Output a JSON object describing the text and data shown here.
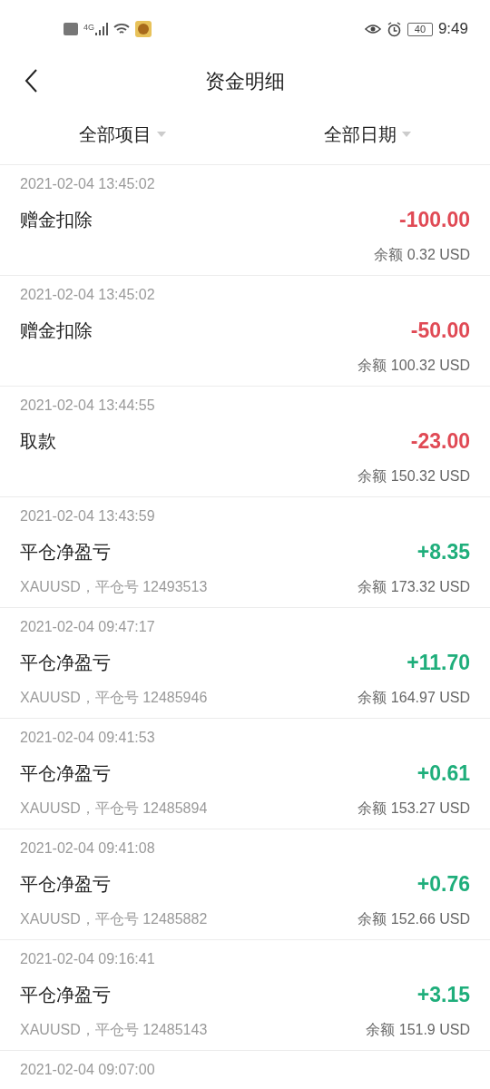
{
  "status_bar": {
    "network": "4G",
    "battery": "40",
    "time": "9:49"
  },
  "header": {
    "title": "资金明细"
  },
  "filters": [
    {
      "label": "全部项目"
    },
    {
      "label": "全部日期"
    }
  ],
  "records": [
    {
      "time": "2021-02-04 13:45:02",
      "title": "赠金扣除",
      "amount": "-100.00",
      "kind": "debit",
      "balance": "余额 0.32 USD"
    },
    {
      "time": "2021-02-04 13:45:02",
      "title": "赠金扣除",
      "amount": "-50.00",
      "kind": "debit",
      "balance": "余额 100.32 USD"
    },
    {
      "time": "2021-02-04 13:44:55",
      "title": "取款",
      "amount": "-23.00",
      "kind": "debit",
      "balance": "余额 150.32 USD"
    },
    {
      "time": "2021-02-04 13:43:59",
      "title": "平仓净盈亏",
      "detail": "XAUUSD，平仓号 12493513",
      "amount": "+8.35",
      "kind": "credit",
      "balance": "余额 173.32 USD"
    },
    {
      "time": "2021-02-04 09:47:17",
      "title": "平仓净盈亏",
      "detail": "XAUUSD，平仓号 12485946",
      "amount": "+11.70",
      "kind": "credit",
      "balance": "余额 164.97 USD"
    },
    {
      "time": "2021-02-04 09:41:53",
      "title": "平仓净盈亏",
      "detail": "XAUUSD，平仓号 12485894",
      "amount": "+0.61",
      "kind": "credit",
      "balance": "余额 153.27 USD"
    },
    {
      "time": "2021-02-04 09:41:08",
      "title": "平仓净盈亏",
      "detail": "XAUUSD，平仓号 12485882",
      "amount": "+0.76",
      "kind": "credit",
      "balance": "余额 152.66 USD"
    },
    {
      "time": "2021-02-04 09:16:41",
      "title": "平仓净盈亏",
      "detail": "XAUUSD，平仓号 12485143",
      "amount": "+3.15",
      "kind": "credit",
      "balance": "余额 151.9 USD"
    },
    {
      "time": "2021-02-04 09:07:00"
    }
  ]
}
